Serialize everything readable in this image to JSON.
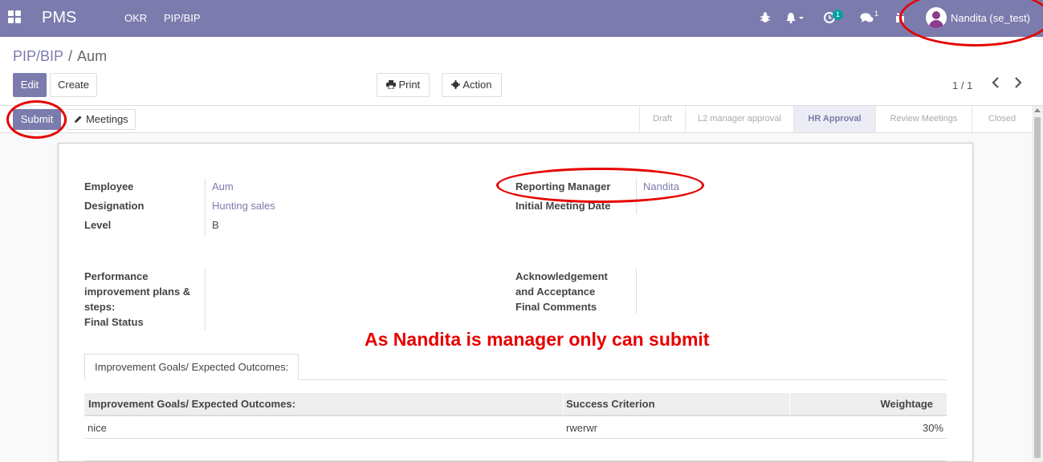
{
  "navbar": {
    "brand": "PMS",
    "menu": [
      "OKR",
      "PIP/BIP"
    ],
    "activity_count": "1",
    "message_count": "1",
    "user_name": "Nandita (se_test)"
  },
  "breadcrumb": {
    "parent": "PIP/BIP",
    "separator": "/",
    "current": "Aum"
  },
  "toolbar": {
    "edit_label": "Edit",
    "create_label": "Create",
    "print_label": "Print",
    "action_label": "Action",
    "pager": "1 / 1"
  },
  "header_buttons": {
    "submit_label": "Submit",
    "meetings_label": "Meetings"
  },
  "stages": [
    {
      "label": "Draft",
      "active": false
    },
    {
      "label": "L2 manager approval",
      "active": false
    },
    {
      "label": "HR Approval",
      "active": true
    },
    {
      "label": "Review Meetings",
      "active": false
    },
    {
      "label": "Closed",
      "active": false
    }
  ],
  "form": {
    "employee_label": "Employee",
    "employee_value": "Aum",
    "designation_label": "Designation",
    "designation_value": "Hunting sales",
    "level_label": "Level",
    "level_value": "B",
    "reporting_manager_label": "Reporting Manager",
    "reporting_manager_value": "Nandita",
    "initial_meeting_label": "Initial Meeting Date",
    "pip_label_1": "Performance",
    "pip_label_2": "improvement plans &",
    "pip_label_3": "steps:",
    "final_status_label": "Final Status",
    "ack_label_1": "Acknowledgement",
    "ack_label_2": "and Acceptance",
    "final_comments_label": "Final Comments"
  },
  "annotation": "As Nandita is manager only can submit",
  "tab": {
    "label": "Improvement Goals/ Expected Outcomes:"
  },
  "table": {
    "columns": [
      "Improvement Goals/ Expected Outcomes:",
      "Success Criterion",
      "Weightage"
    ],
    "rows": [
      [
        "nice",
        "rwerwr",
        "30%"
      ]
    ]
  },
  "colors": {
    "brand": "#7c7bad",
    "annotation": "#e60000"
  }
}
